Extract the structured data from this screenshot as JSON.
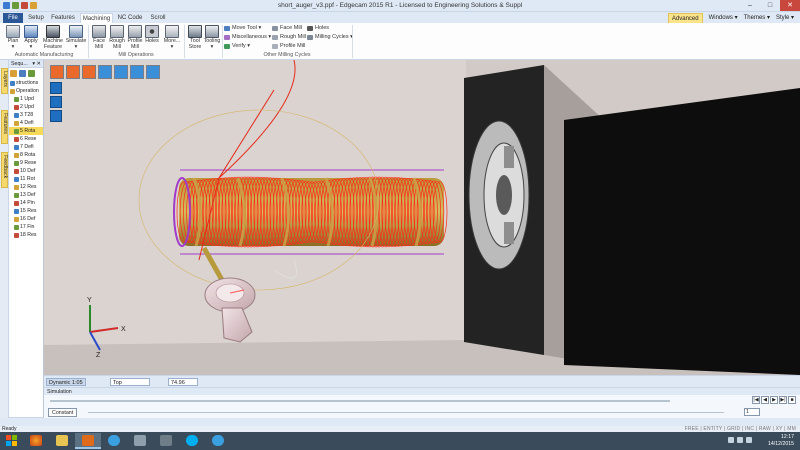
{
  "window": {
    "title": "short_auger_v3.ppf - Edgecam 2015 R1  -  Licensed to Engineering Solutions & Suppl",
    "buttons": [
      "–",
      "□",
      "✕"
    ]
  },
  "tabs": [
    "File",
    "Setup",
    "Features",
    "Machining",
    "NC Code",
    "Scroll"
  ],
  "active_tab": "Machining",
  "ribbon_right": {
    "advanced": "Advanced",
    "windows": "Windows ▾",
    "themes": "Themes ▾",
    "style": "Style ▾"
  },
  "ribbon": {
    "automatic": {
      "label": "Automatic Manufacturing",
      "buttons": [
        {
          "l1": "Plan",
          "l2": "▾"
        },
        {
          "l1": "Apply",
          "l2": "▾"
        },
        {
          "l1": "Machine",
          "l2": "Feature"
        },
        {
          "l1": "Simulate",
          "l2": "▾"
        }
      ]
    },
    "mill": {
      "label": "Mill Operations",
      "buttons": [
        {
          "l1": "Face",
          "l2": "Mill"
        },
        {
          "l1": "Rough",
          "l2": "Mill"
        },
        {
          "l1": "Profile",
          "l2": "Mill"
        },
        {
          "l1": "Holes",
          "l2": ""
        },
        {
          "l1": "More...",
          "l2": "▾"
        }
      ]
    },
    "tools": {
      "buttons": [
        {
          "l1": "Tool",
          "l2": "Store"
        },
        {
          "l1": "Tooling",
          "l2": "▾"
        }
      ]
    },
    "other": {
      "label": "Other Milling Cycles",
      "move_tool": "Move Tool ▾",
      "miscellaneous": "Miscellaneous ▾",
      "verify": "Verify ▾",
      "face_mill": "Face Mill",
      "rough_mill": "Rough Mill",
      "profile_mill": "Profile Mill",
      "holes": "Holes",
      "milling_cycles": "Milling Cycles ▾"
    }
  },
  "side_tabs": [
    "Layers",
    "Features",
    "Feedback"
  ],
  "sequence": {
    "title": "Sequ...",
    "pin": "▾ ✕",
    "items": [
      {
        "text": "structions",
        "depth": 0
      },
      {
        "text": "Operation",
        "depth": 0
      },
      {
        "text": "1 Upd",
        "depth": 1
      },
      {
        "text": "2 Upd",
        "depth": 1
      },
      {
        "text": "3 T28",
        "depth": 1
      },
      {
        "text": "4 Defi",
        "depth": 1
      },
      {
        "text": "5 Rota",
        "depth": 1
      },
      {
        "text": "6 Rese",
        "depth": 1
      },
      {
        "text": "7 Defi",
        "depth": 1
      },
      {
        "text": "8 Rota",
        "depth": 1
      },
      {
        "text": "9 Rese",
        "depth": 1
      },
      {
        "text": "10 Def",
        "depth": 1
      },
      {
        "text": "11 Rot",
        "depth": 1
      },
      {
        "text": "12 Res",
        "depth": 1
      },
      {
        "text": "13 Def",
        "depth": 1
      },
      {
        "text": "14 Pin",
        "depth": 1
      },
      {
        "text": "15 Res",
        "depth": 1
      },
      {
        "text": "16 Def",
        "depth": 1
      },
      {
        "text": "17 Fin",
        "depth": 1
      },
      {
        "text": "18 Res",
        "depth": 1
      }
    ]
  },
  "viewbar": {
    "dynamic": "Dynamic 1:05",
    "view": "Top",
    "zoom": "74.96"
  },
  "simulation": {
    "title": "Simulation",
    "constant": "Constant",
    "step": "1",
    "controls": [
      "|◀",
      "◀",
      "▶",
      "▶|",
      "■"
    ]
  },
  "status": {
    "left": "Ready",
    "right": "FREE | ENTITY | GRID | INC | RAW | XY | MM"
  },
  "taskbar": {
    "time": "12:17",
    "date": "14/12/2015"
  },
  "colors": {
    "accent": "#2b5797",
    "toolpath": "#ff2a1a",
    "selection": "#f7d95a"
  }
}
